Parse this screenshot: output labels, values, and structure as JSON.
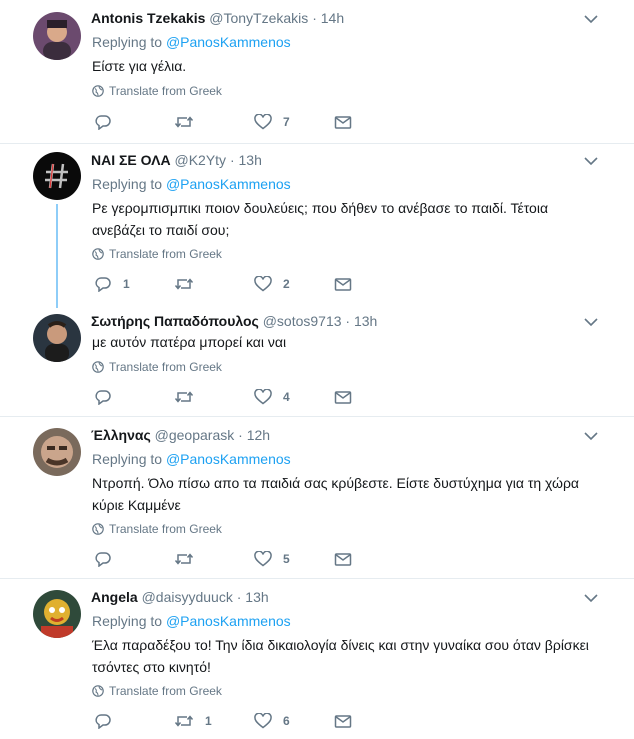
{
  "translate_label": "Translate from Greek",
  "replying_prefix": "Replying to",
  "tweets": [
    {
      "name": "Antonis Tzekakis",
      "handle": "@TonyTzekakis",
      "time": "14h",
      "replying_to": "@PanosKammenos",
      "text": "Είστε για γέλια.",
      "replies": "",
      "retweets": "",
      "likes": "7"
    },
    {
      "name": "ΝΑΙ ΣΕ ΟΛΑ",
      "handle": "@K2Yty",
      "time": "13h",
      "replying_to": "@PanosKammenos",
      "text": "Ρε γερομπισμπικι ποιον δουλεύεις; που δήθεν το ανέβασε το παιδί. Τέτοια ανεβάζει το παιδί σου;",
      "replies": "1",
      "retweets": "",
      "likes": "2"
    },
    {
      "name": "Σωτήρης Παπαδόπουλος",
      "handle": "@sotos9713",
      "time": "13h",
      "replying_to": "",
      "text": "με αυτόν πατέρα μπορεί και ναι",
      "replies": "",
      "retweets": "",
      "likes": "4"
    },
    {
      "name": "Έλληνας",
      "handle": "@geoparask",
      "time": "12h",
      "replying_to": "@PanosKammenos",
      "text": "Ντροπή. Όλο πίσω απο τα παιδιά σας κρύβεστε. Είστε δυστύχημα για τη χώρα κύριε Καμμένε",
      "replies": "",
      "retweets": "",
      "likes": "5"
    },
    {
      "name": "Angela",
      "handle": "@daisyyduuck",
      "time": "13h",
      "replying_to": "@PanosKammenos",
      "text": "Έλα παραδέξου το! Την ίδια δικαιολογία δίνεις και στην γυναίκα σου όταν βρίσκει τσόντες στο κινητό!",
      "replies": "",
      "retweets": "1",
      "likes": "6"
    }
  ],
  "colors": {
    "mention": "#1da1f2",
    "muted": "#657786",
    "text": "#14171a",
    "thread_line": "#8ecdf8",
    "divider": "#e6ecf0"
  },
  "icons": [
    "reply-icon",
    "retweet-icon",
    "like-icon",
    "direct-message-icon",
    "globe-icon",
    "chevron-down-icon"
  ]
}
